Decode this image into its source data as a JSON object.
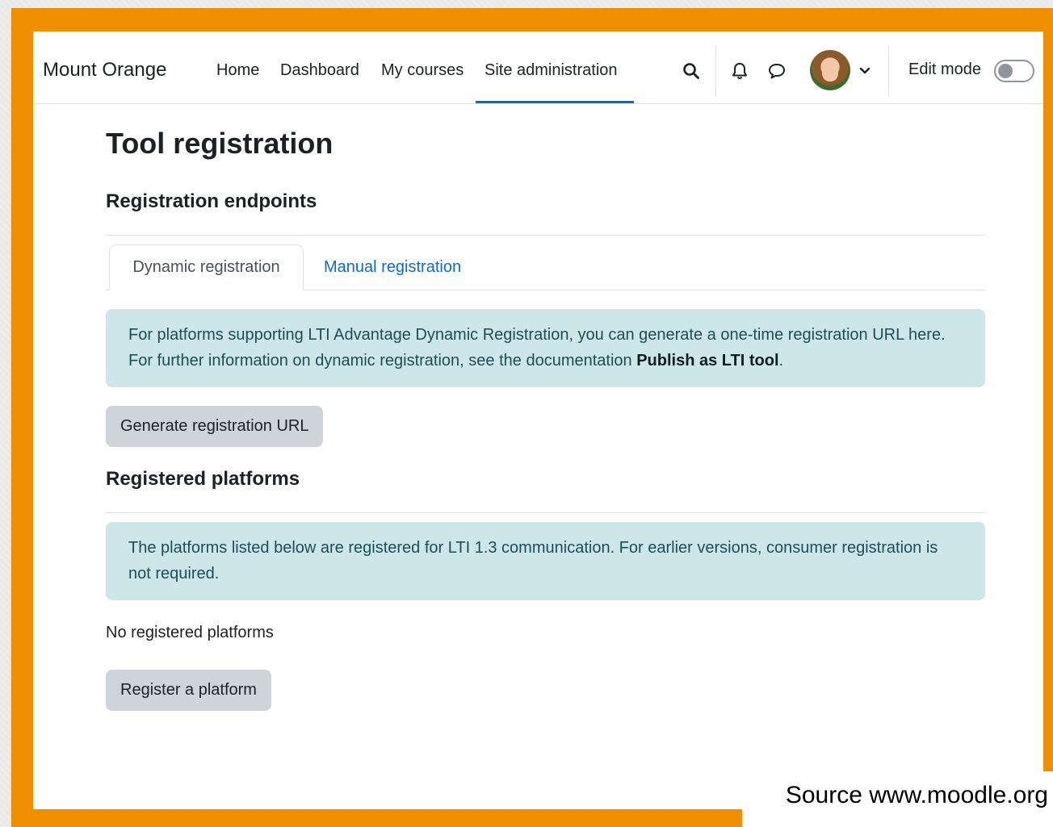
{
  "navbar": {
    "brand": "Mount Orange",
    "links": [
      {
        "label": "Home"
      },
      {
        "label": "Dashboard"
      },
      {
        "label": "My courses"
      },
      {
        "label": "Site administration"
      }
    ],
    "edit_mode_label": "Edit mode",
    "edit_mode_on": false
  },
  "page": {
    "title": "Tool registration",
    "endpoints_heading": "Registration endpoints",
    "tabs": [
      {
        "label": "Dynamic registration",
        "active": true
      },
      {
        "label": "Manual registration",
        "active": false
      }
    ],
    "dynamic_info_part1": "For platforms supporting LTI Advantage Dynamic Registration, you can generate a one-time registration URL here. For further information on dynamic registration, see the documentation ",
    "dynamic_info_link": "Publish as LTI tool",
    "dynamic_info_part2": ".",
    "generate_button": "Generate registration URL",
    "platforms_heading": "Registered platforms",
    "platforms_info": "The platforms listed below are registered for LTI 1.3 communication. For earlier versions, consumer registration is not required.",
    "no_platforms": "No registered platforms",
    "register_button": "Register a platform"
  },
  "source_caption": "Source www.moodle.org",
  "colors": {
    "frame": "#ef8f00",
    "accent": "#0f6cbf",
    "alert_bg": "#cce6ea",
    "button_bg": "#ced4da"
  }
}
